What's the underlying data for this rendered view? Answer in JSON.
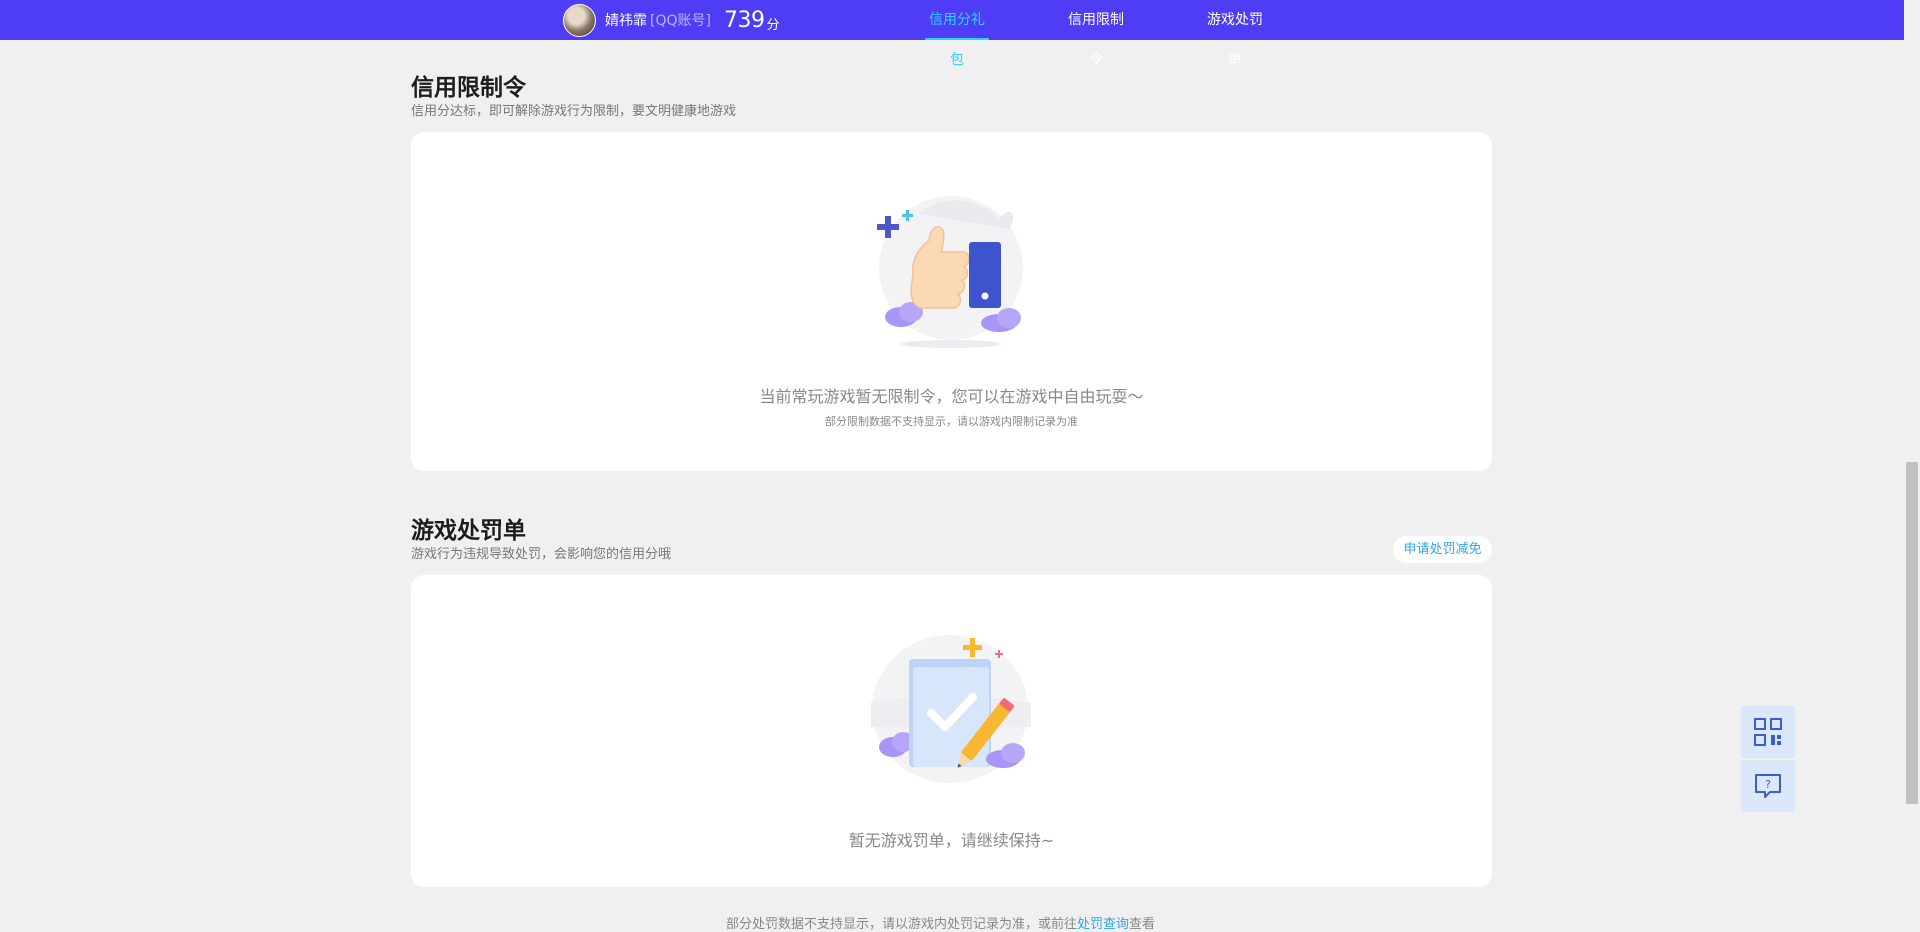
{
  "header": {
    "username": "婧祎霏",
    "account_type": "[QQ账号]",
    "score": "739",
    "score_unit": "分",
    "tabs": [
      {
        "label": "信用分礼包",
        "active": true
      },
      {
        "label": "信用限制令",
        "active": false
      },
      {
        "label": "游戏处罚单",
        "active": false
      }
    ],
    "active_color": "#2fd3ff",
    "bar_color": "#4f3df5"
  },
  "restriction": {
    "title": "信用限制令",
    "subtitle": "信用分达标，即可解除游戏行为限制，要文明健康地游戏",
    "empty_main": "当前常玩游戏暂无限制令，您可以在游戏中自由玩耍～",
    "empty_sub": "部分限制数据不支持显示，请以游戏内限制记录为准"
  },
  "penalty": {
    "title": "游戏处罚单",
    "subtitle": "游戏行为违规导致处罚，会影响您的信用分哦",
    "action_label": "申请处罚减免",
    "empty_main": "暂无游戏罚单，请继续保持~"
  },
  "footer": {
    "note_prefix": "部分处罚数据不支持显示，请以游戏内处罚记录为准，或前往",
    "note_link": "处罚查询",
    "note_suffix": "查看"
  },
  "float_buttons": [
    {
      "icon": "qrcode-icon"
    },
    {
      "icon": "help-chat-icon"
    }
  ]
}
